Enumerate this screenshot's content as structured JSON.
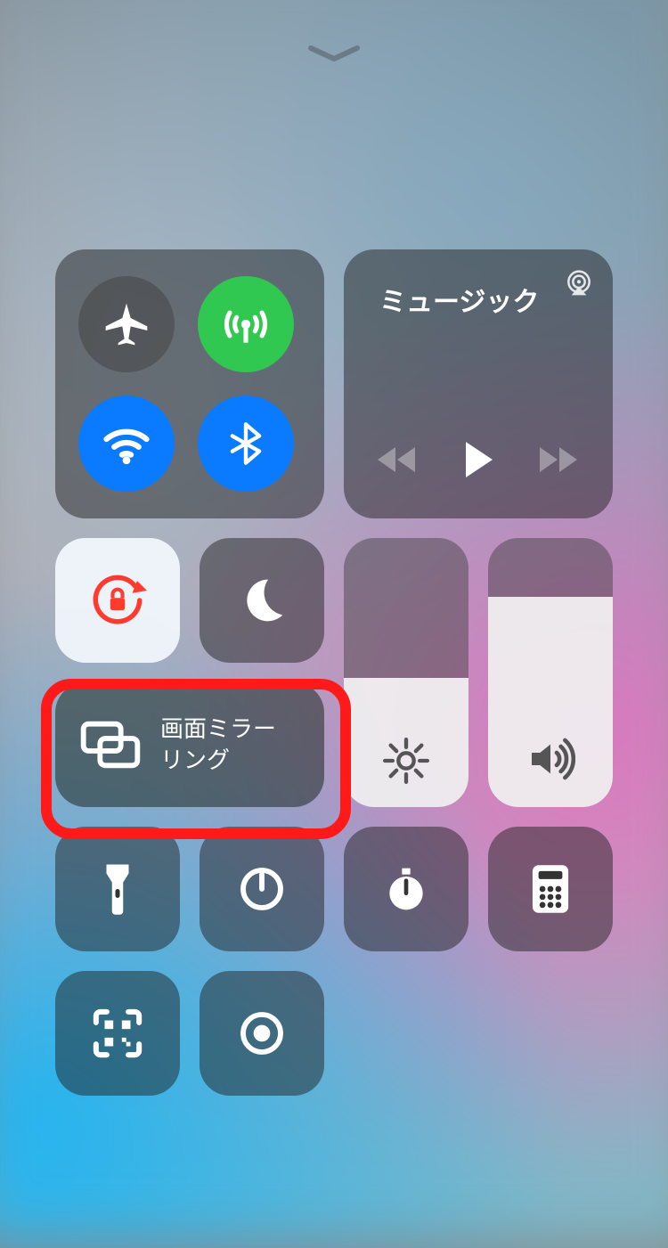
{
  "media": {
    "title": "ミュージック"
  },
  "mirror": {
    "label_line1": "画面ミラー",
    "label_line2": "リング"
  },
  "sliders": {
    "brightness_percent": 48,
    "volume_percent": 78
  },
  "toggles": {
    "airplane": false,
    "cellular": true,
    "wifi": true,
    "bluetooth": true,
    "orientation_lock": true,
    "do_not_disturb": false
  },
  "colors": {
    "active_blue": "#0a7aff",
    "active_green": "#30c850",
    "lock_red": "#ff3b30",
    "highlight": "#ff1a1a"
  },
  "icons": {
    "airplane": "airplane-icon",
    "cellular": "cellular-icon",
    "wifi": "wifi-icon",
    "bluetooth": "bluetooth-icon",
    "airplay": "airplay-icon",
    "rewind": "rewind-icon",
    "play": "play-icon",
    "forward": "forward-icon",
    "orientation_lock": "orientation-lock-icon",
    "dnd": "moon-icon",
    "brightness": "brightness-icon",
    "volume": "volume-icon",
    "mirror": "screen-mirror-icon",
    "flashlight": "flashlight-icon",
    "timer": "timer-icon",
    "stopwatch": "stopwatch-icon",
    "calculator": "calculator-icon",
    "qr": "qr-scan-icon",
    "record": "screen-record-icon",
    "chevron": "chevron-down-icon"
  }
}
